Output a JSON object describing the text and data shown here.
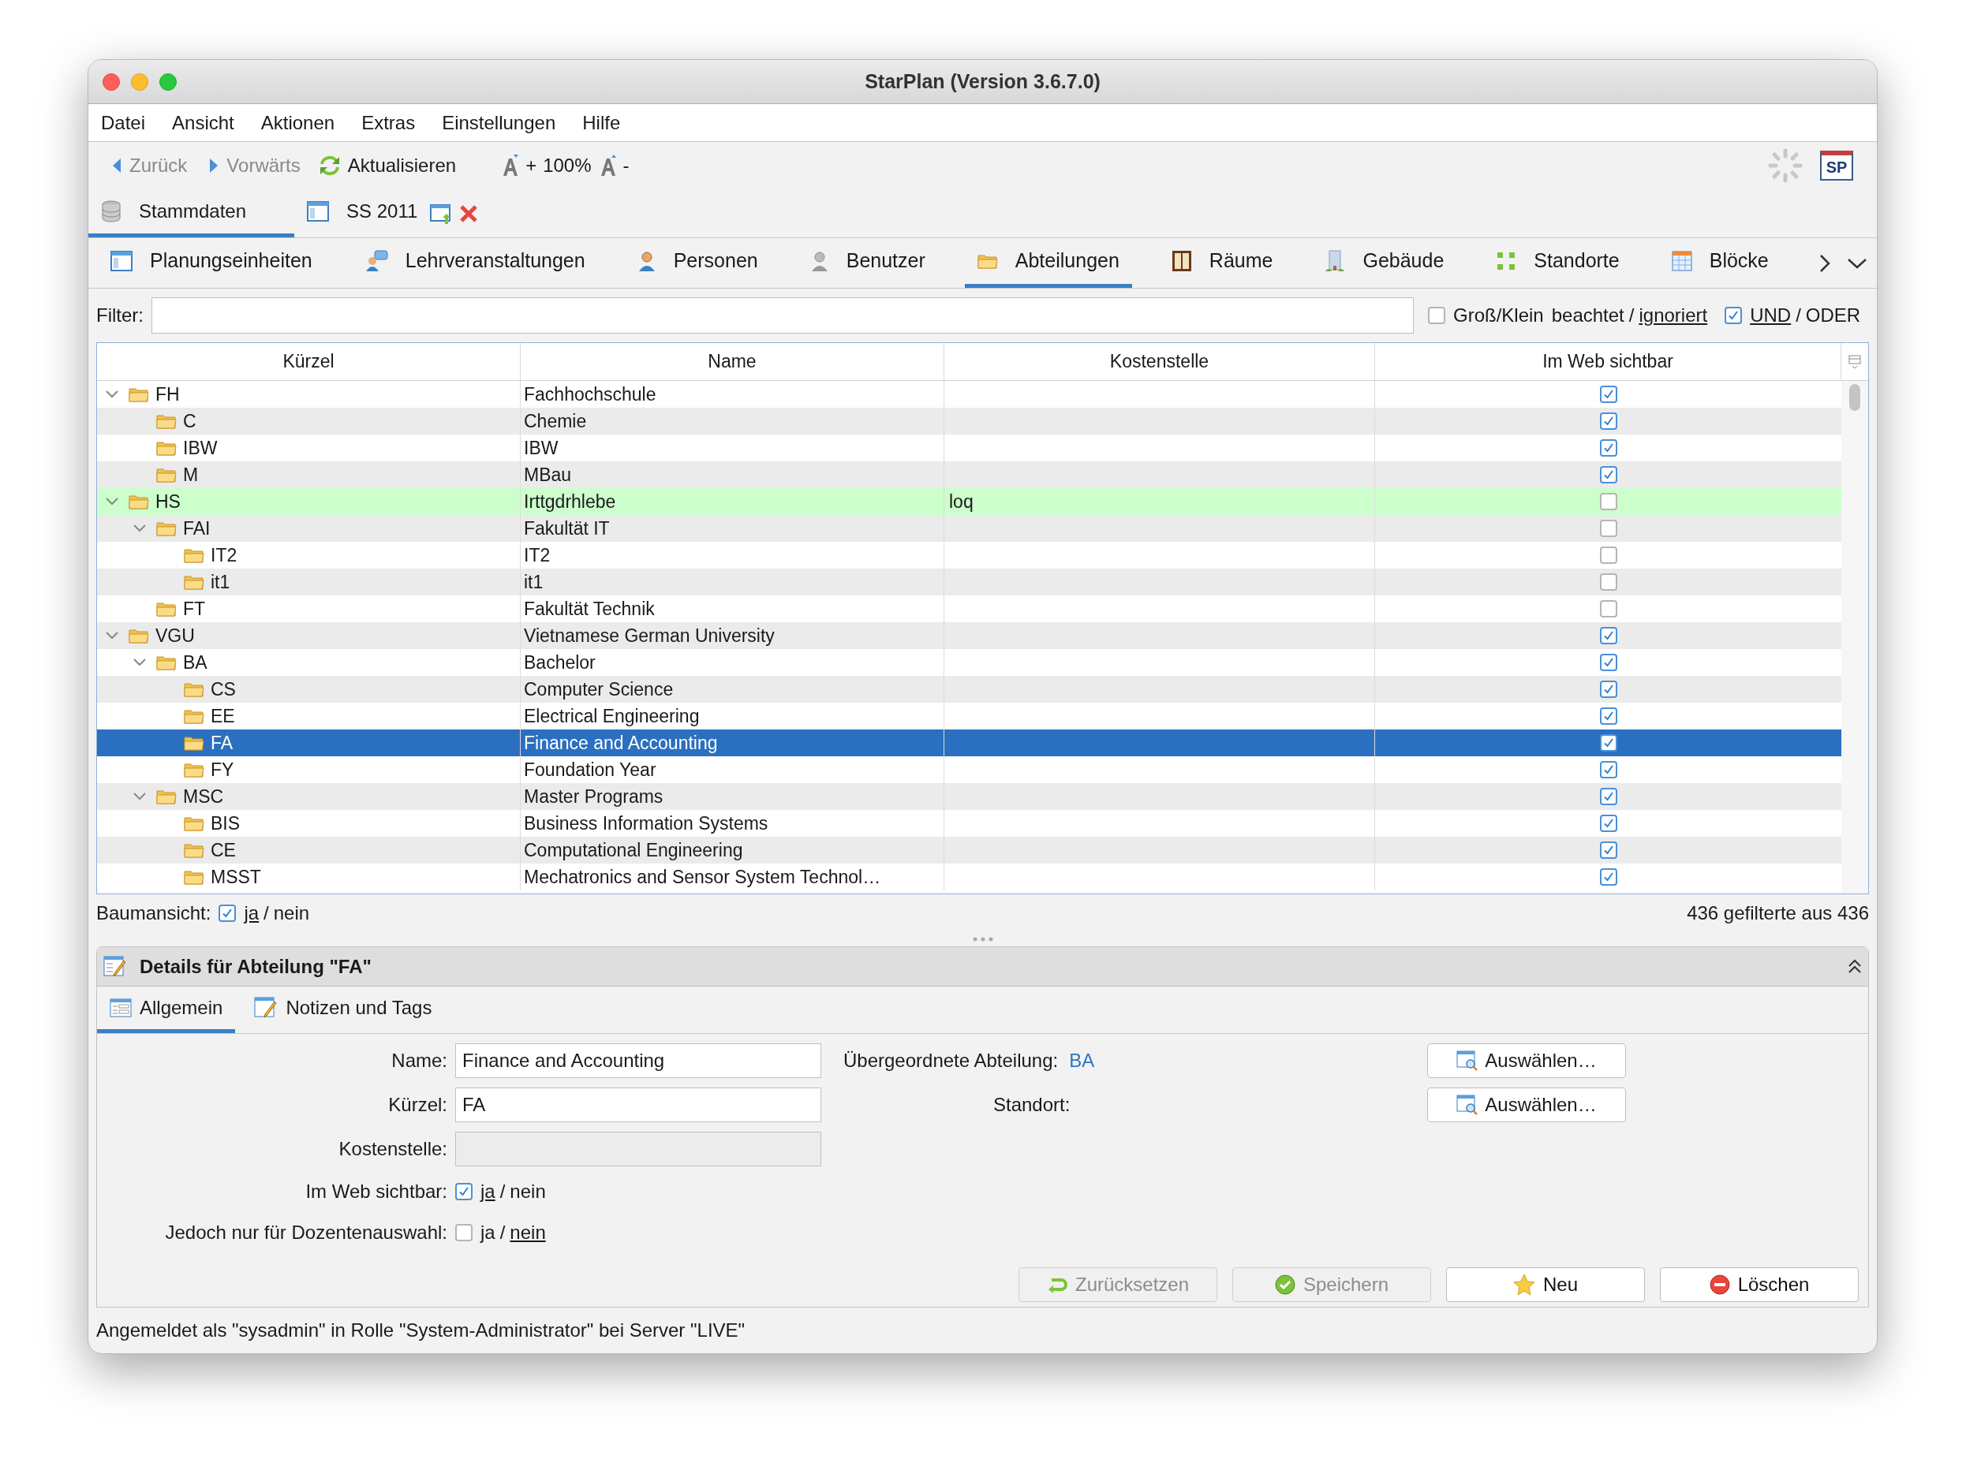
{
  "window": {
    "title": "StarPlan (Version 3.6.7.0)"
  },
  "menu": [
    "Datei",
    "Ansicht",
    "Aktionen",
    "Extras",
    "Einstellungen",
    "Hilfe"
  ],
  "toolbar": {
    "back": {
      "label": "Zurück",
      "disabled": true
    },
    "forward": {
      "label": "Vorwärts",
      "disabled": true
    },
    "refresh": {
      "label": "Aktualisieren",
      "disabled": false
    },
    "zoom_plus": "+",
    "zoom": "100%",
    "zoom_minus": "-",
    "logo": "SP"
  },
  "perspectives": [
    {
      "label": "Stammdaten",
      "selected": true,
      "kind": "database"
    },
    {
      "label": "SS 2011",
      "selected": false,
      "kind": "plan"
    }
  ],
  "module_tabs": [
    {
      "label": "Planungseinheiten",
      "selected": false,
      "kind": "plan"
    },
    {
      "label": "Lehrveranstaltungen",
      "selected": false,
      "kind": "lecture"
    },
    {
      "label": "Personen",
      "selected": false,
      "kind": "person"
    },
    {
      "label": "Benutzer",
      "selected": false,
      "kind": "user"
    },
    {
      "label": "Abteilungen",
      "selected": true,
      "kind": "folder"
    },
    {
      "label": "Räume",
      "selected": false,
      "kind": "room"
    },
    {
      "label": "Gebäude",
      "selected": false,
      "kind": "building"
    },
    {
      "label": "Standorte",
      "selected": false,
      "kind": "location"
    },
    {
      "label": "Blöcke",
      "selected": false,
      "kind": "blocks"
    }
  ],
  "filter": {
    "label": "Filter:",
    "case_toggle": {
      "checked": false,
      "prefix": "Groß/Klein",
      "separator": "/",
      "options": [
        {
          "label": "beachtet",
          "selected": false
        },
        {
          "label": "ignoriert",
          "selected": true
        }
      ]
    },
    "and_or": {
      "checked": true,
      "separator": "/",
      "options": [
        {
          "label": "UND",
          "selected": true
        },
        {
          "label": "ODER",
          "selected": false
        }
      ]
    }
  },
  "table": {
    "columns": [
      "Kürzel",
      "Name",
      "Kostenstelle",
      "Im Web sichtbar"
    ],
    "rows": [
      {
        "kurzel": "FH",
        "name": "Fachhochschule",
        "web_visible": true,
        "selected": false,
        "highlighted": false,
        "expanded": true,
        "children": [
          {
            "kurzel": "C",
            "name": "Chemie",
            "web_visible": true,
            "selected": false,
            "highlighted": false
          },
          {
            "kurzel": "IBW",
            "name": "IBW",
            "web_visible": true,
            "selected": false,
            "highlighted": false
          },
          {
            "kurzel": "M",
            "name": "MBau",
            "web_visible": true,
            "selected": false,
            "highlighted": false
          }
        ]
      },
      {
        "kurzel": "HS",
        "name": "Irttgdrhlebe",
        "kostenstelle": "loq",
        "web_visible": false,
        "selected": false,
        "highlighted": true,
        "expanded": true,
        "children": [
          {
            "kurzel": "FAI",
            "name": "Fakultät IT",
            "web_visible": false,
            "selected": false,
            "highlighted": false,
            "expanded": true,
            "children": [
              {
                "kurzel": "IT2",
                "name": "IT2",
                "web_visible": false,
                "selected": false,
                "highlighted": false
              },
              {
                "kurzel": "it1",
                "name": "it1",
                "web_visible": false,
                "selected": false,
                "highlighted": false
              }
            ]
          },
          {
            "kurzel": "FT",
            "name": "Fakultät Technik",
            "web_visible": false,
            "selected": false,
            "highlighted": false
          }
        ]
      },
      {
        "kurzel": "VGU",
        "name": "Vietnamese German University",
        "web_visible": true,
        "selected": false,
        "highlighted": false,
        "expanded": true,
        "children": [
          {
            "kurzel": "BA",
            "name": "Bachelor",
            "web_visible": true,
            "selected": false,
            "highlighted": false,
            "expanded": true,
            "children": [
              {
                "kurzel": "CS",
                "name": "Computer Science",
                "web_visible": true,
                "selected": false,
                "highlighted": false
              },
              {
                "kurzel": "EE",
                "name": "Electrical Engineering",
                "web_visible": true,
                "selected": false,
                "highlighted": false
              },
              {
                "kurzel": "FA",
                "name": "Finance and Accounting",
                "web_visible": true,
                "selected": true,
                "highlighted": false
              },
              {
                "kurzel": "FY",
                "name": "Foundation Year",
                "web_visible": true,
                "selected": false,
                "highlighted": false
              }
            ]
          },
          {
            "kurzel": "MSC",
            "name": "Master Programs",
            "web_visible": true,
            "selected": false,
            "highlighted": false,
            "expanded": true,
            "children": [
              {
                "kurzel": "BIS",
                "name": "Business Information Systems",
                "web_visible": true,
                "selected": false,
                "highlighted": false
              },
              {
                "kurzel": "CE",
                "name": "Computational Engineering",
                "web_visible": true,
                "selected": false,
                "highlighted": false
              },
              {
                "kurzel": "MSST",
                "name": "Mechatronics and Sensor System Technol…",
                "web_visible": true,
                "selected": false,
                "highlighted": false
              }
            ]
          }
        ]
      }
    ]
  },
  "tree_view": {
    "label": "Baumansicht:",
    "checked": true,
    "separator": "/",
    "options": [
      {
        "label": "ja",
        "selected": true
      },
      {
        "label": "nein",
        "selected": false
      }
    ]
  },
  "count": "436 gefilterte aus 436",
  "details": {
    "title": "Details für Abteilung \"FA\"",
    "tabs": [
      {
        "label": "Allgemein",
        "selected": true
      },
      {
        "label": "Notizen und Tags",
        "selected": false
      }
    ],
    "fields": [
      {
        "label": "Name:",
        "value": "Finance and Accounting",
        "disabled": false
      },
      {
        "label": "Kürzel:",
        "value": "FA",
        "disabled": false
      },
      {
        "label": "Kostenstelle:",
        "disabled": true
      }
    ],
    "toggles": [
      {
        "label": "Im Web sichtbar:",
        "checked": true,
        "separator": "/",
        "options": [
          {
            "label": "ja",
            "selected": true
          },
          {
            "label": "nein",
            "selected": false
          }
        ]
      },
      {
        "label": "Jedoch nur für Dozentenauswahl:",
        "checked": false,
        "separator": "/",
        "options": [
          {
            "label": "ja",
            "selected": false
          },
          {
            "label": "nein",
            "selected": true
          }
        ]
      }
    ],
    "parent": {
      "label": "Übergeordnete Abteilung:",
      "value": "BA",
      "button": "Auswählen…"
    },
    "location": {
      "label": "Standort:",
      "button": "Auswählen…"
    },
    "actions": [
      {
        "label": "Zurücksetzen",
        "kind": "reset",
        "disabled": true
      },
      {
        "label": "Speichern",
        "kind": "save",
        "disabled": true
      },
      {
        "label": "Neu",
        "kind": "new",
        "disabled": false
      },
      {
        "label": "Löschen",
        "kind": "delete",
        "disabled": false
      }
    ]
  },
  "status_bar": "Angemeldet als \"sysadmin\" in Rolle \"System-Administrator\" bei Server \"LIVE\""
}
